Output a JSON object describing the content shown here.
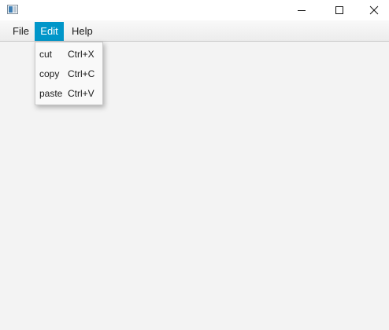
{
  "window": {
    "icons": {
      "app": "app-icon",
      "minimize": "minimize-icon",
      "maximize": "maximize-icon",
      "close": "close-icon"
    }
  },
  "menubar": {
    "file": "File",
    "edit": "Edit",
    "help": "Help",
    "active": "Edit",
    "accent_color": "#0096c9"
  },
  "edit_menu": {
    "items": [
      {
        "label": "cut",
        "accelerator": "Ctrl+X"
      },
      {
        "label": "copy",
        "accelerator": "Ctrl+C"
      },
      {
        "label": "paste",
        "accelerator": "Ctrl+V"
      }
    ]
  }
}
